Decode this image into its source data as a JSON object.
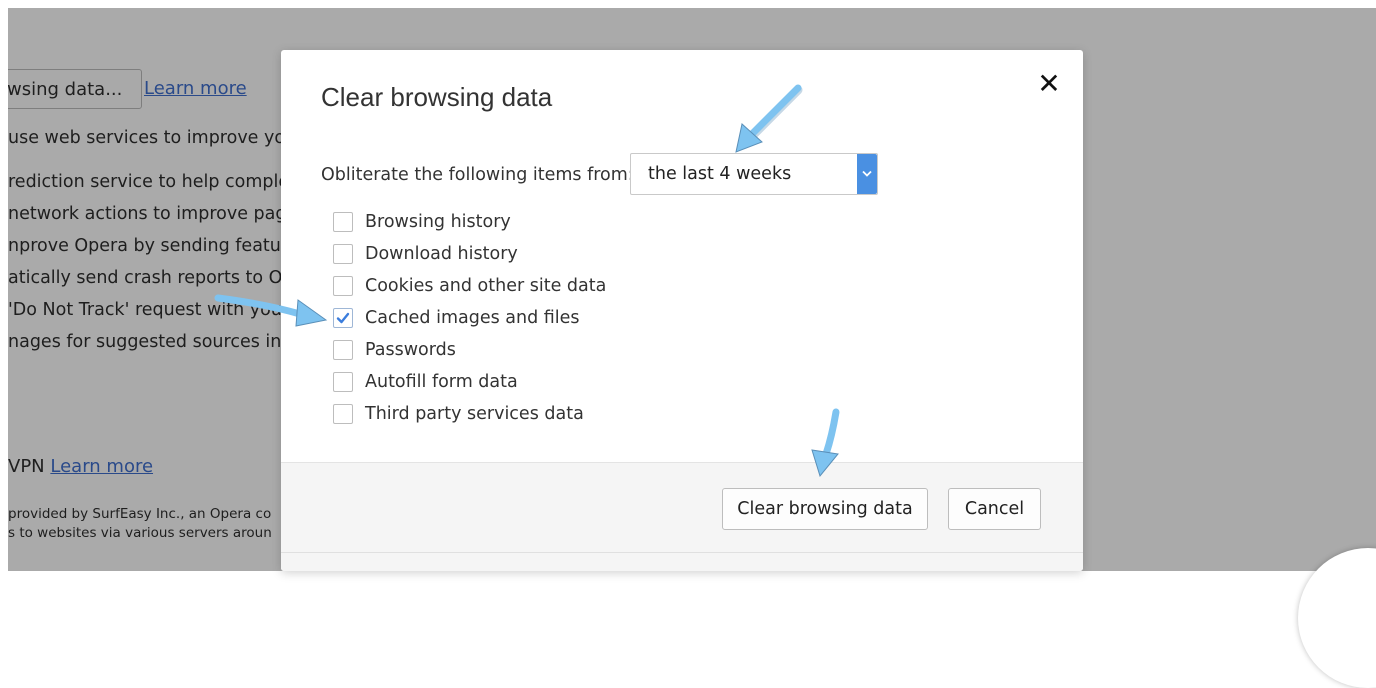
{
  "background": {
    "button_label": "wsing data...",
    "learn_more": "Learn more",
    "lines": [
      "use web services to improve yo",
      "rediction service to help comple",
      "network actions to improve pag",
      "nprove Opera by sending feature",
      "atically send crash reports to Op",
      "'Do Not Track' request with you",
      "nages for suggested sources in N"
    ],
    "vpn_label": "VPN",
    "vpn_learn_more": "Learn more",
    "small_lines": [
      "provided by SurfEasy Inc., an Opera co",
      "s to websites via various servers aroun"
    ]
  },
  "dialog": {
    "title": "Clear browsing data",
    "close_glyph": "✕",
    "range_label": "Obliterate the following items from:",
    "range_value": "the last 4 weeks",
    "options": [
      {
        "label": "Browsing history",
        "checked": false
      },
      {
        "label": "Download history",
        "checked": false
      },
      {
        "label": "Cookies and other site data",
        "checked": false
      },
      {
        "label": "Cached images and files",
        "checked": true
      },
      {
        "label": "Passwords",
        "checked": false
      },
      {
        "label": "Autofill form data",
        "checked": false
      },
      {
        "label": "Third party services data",
        "checked": false
      }
    ],
    "clear_button": "Clear browsing data",
    "cancel_button": "Cancel"
  },
  "colors": {
    "overlay": "#aaaaaa",
    "accent": "#4a90e2",
    "annotation_arrow": "#7ec3f0"
  },
  "icons": {
    "close": "close-icon",
    "dropdown": "chevron-down-icon",
    "check": "checkmark-icon",
    "annotation": "arrow-annotation-icon"
  }
}
